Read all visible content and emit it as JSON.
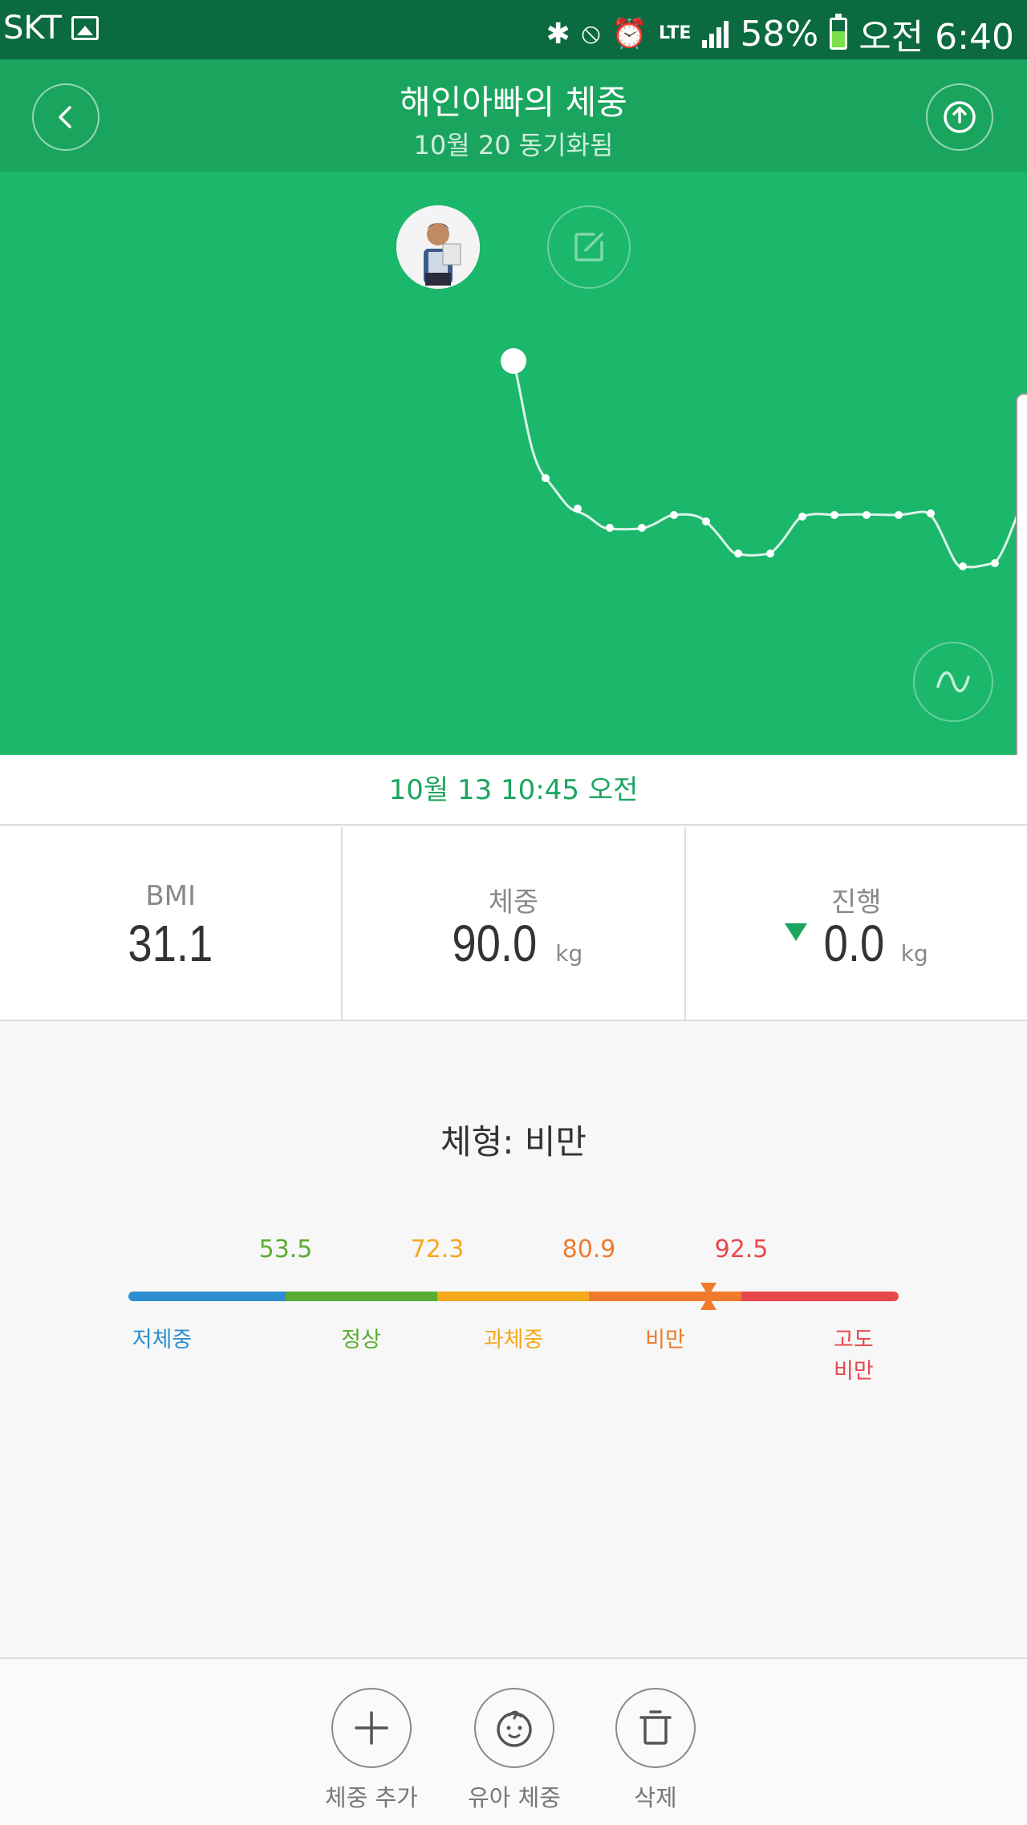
{
  "status_bar": {
    "carrier": "SKT",
    "network": "LTE",
    "battery": "58%",
    "battery_level": 0.58,
    "time": "오전 6:40"
  },
  "header": {
    "title": "해인아빠의 체중",
    "subtitle": "10월 20 동기화됨"
  },
  "chart": {
    "selected_datetime": "10월 13 10:45 오전"
  },
  "stats": {
    "bmi_label": "BMI",
    "bmi_value": "31.1",
    "weight_label": "체중",
    "weight_value": "90.0",
    "weight_unit": "kg",
    "progress_label": "진행",
    "progress_value": "0.0",
    "progress_unit": "kg"
  },
  "body_type": {
    "label": "체형: 비만",
    "thresholds": [
      "53.5",
      "72.3",
      "80.9",
      "92.5"
    ],
    "categories": [
      "저체중",
      "정상",
      "과체중",
      "비만",
      "고도비만"
    ],
    "current_weight": 90.0,
    "colors": {
      "underweight": "#2e8fd0",
      "normal": "#5aad32",
      "overweight": "#f4a81c",
      "obese": "#f07a2c",
      "severely_obese": "#e8474b"
    }
  },
  "actions": {
    "add_weight": "체중 추가",
    "baby_weight": "유아 체중",
    "delete": "삭제"
  },
  "theme": {
    "primary": "#1bb76b",
    "header": "#1aa55e",
    "status_bar": "#0b6a3f"
  }
}
